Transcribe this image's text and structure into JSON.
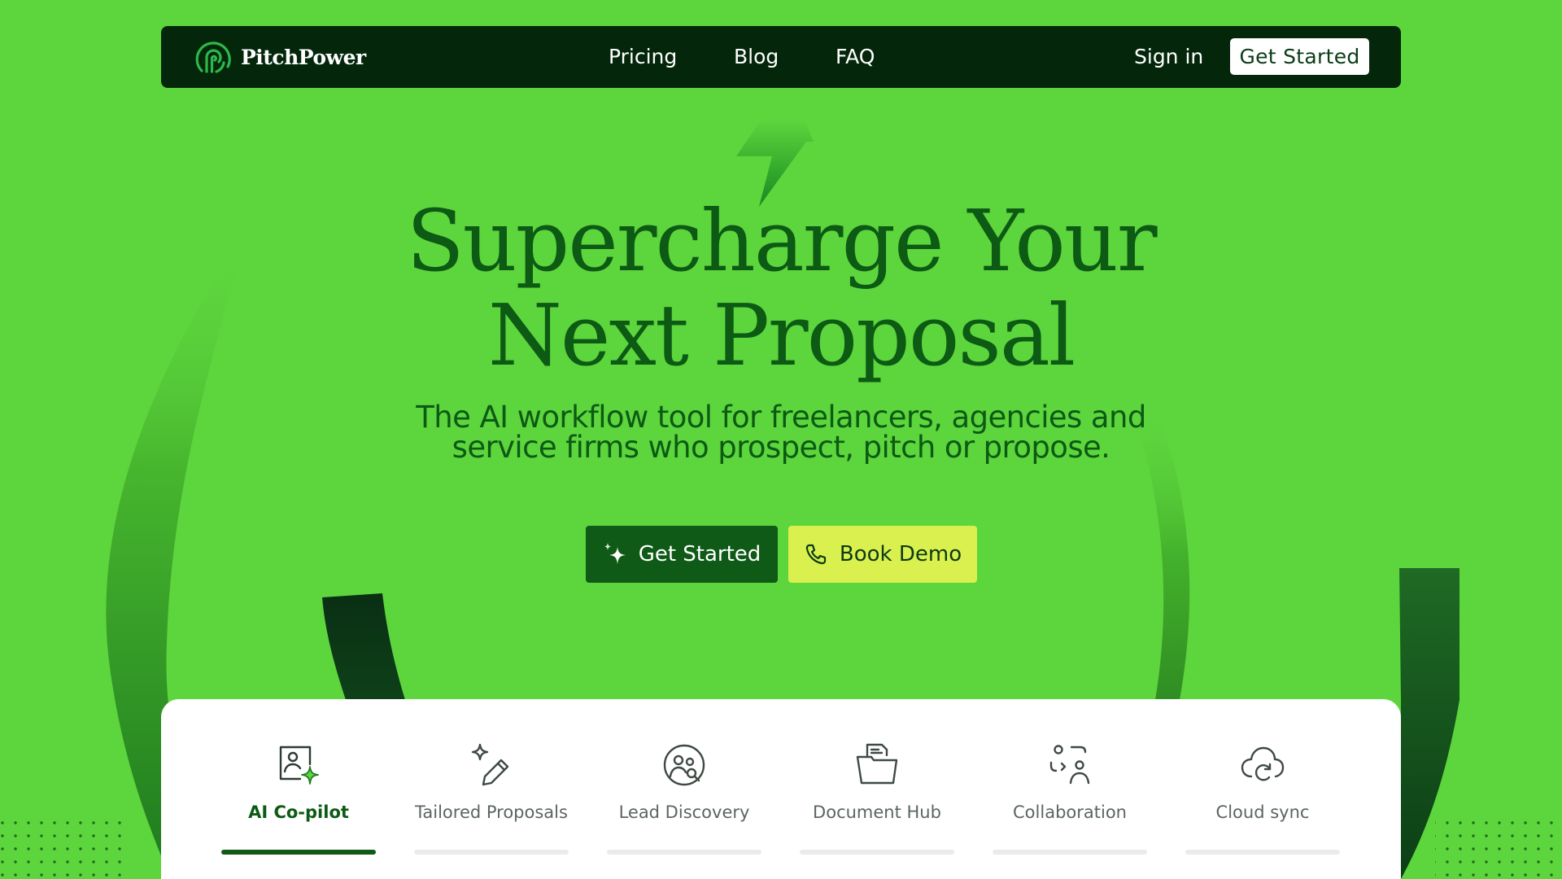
{
  "brand": {
    "name": "PitchPower",
    "logo_icon": "fingerprint-spiral-logo"
  },
  "nav": {
    "links": [
      "Pricing",
      "Blog",
      "FAQ"
    ],
    "sign_in": "Sign in",
    "cta": "Get Started"
  },
  "hero": {
    "title_line1": "Supercharge Your",
    "title_line2": "Next Proposal",
    "subtitle_line1": "The AI workflow tool for freelancers, agencies and",
    "subtitle_line2": "service firms who prospect, pitch or propose.",
    "primary_button": {
      "label": "Get Started",
      "icon": "sparkle-icon"
    },
    "secondary_button": {
      "label": "Book Demo",
      "icon": "phone-icon"
    }
  },
  "features": {
    "active_index": 0,
    "tabs": [
      {
        "label": "AI Co-pilot",
        "icon": "ai-profile-sparkle-icon"
      },
      {
        "label": "Tailored Proposals",
        "icon": "pencil-sparkle-icon"
      },
      {
        "label": "Lead Discovery",
        "icon": "user-search-icon"
      },
      {
        "label": "Document Hub",
        "icon": "folder-document-icon"
      },
      {
        "label": "Collaboration",
        "icon": "people-icon"
      },
      {
        "label": "Cloud sync",
        "icon": "cloud-sync-icon"
      }
    ]
  },
  "colors": {
    "background": "#5dd53d",
    "nav_bg": "#04270c",
    "heading": "#0c5a14",
    "primary_button": "#0e5a16",
    "secondary_button": "#d9f04e",
    "card": "#ffffff"
  }
}
